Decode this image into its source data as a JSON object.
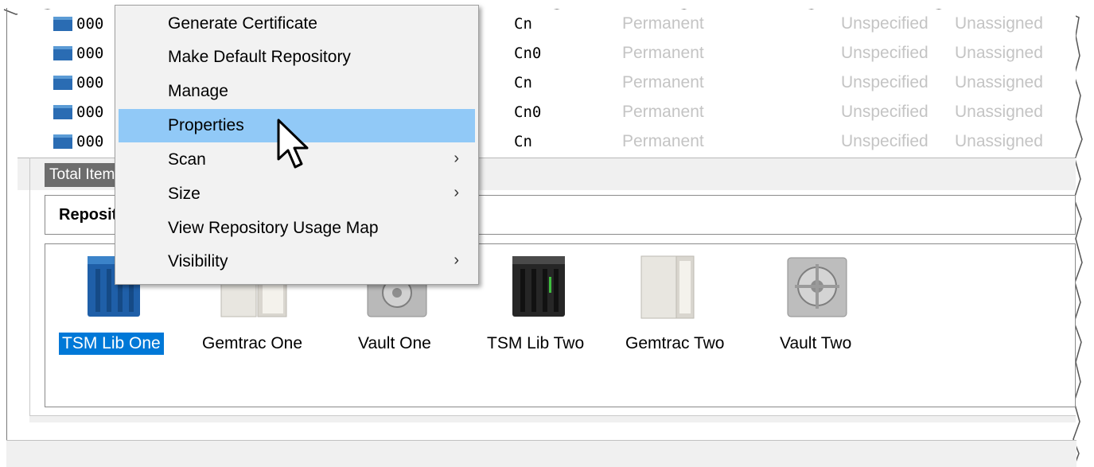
{
  "table": {
    "rows": [
      {
        "id": "000",
        "code": "Cn",
        "retention": "Permanent",
        "col_a": "Unspecified",
        "col_b": "Unassigned"
      },
      {
        "id": "000",
        "code": "Cn0",
        "retention": "Permanent",
        "col_a": "Unspecified",
        "col_b": "Unassigned"
      },
      {
        "id": "000",
        "code": "Cn",
        "retention": "Permanent",
        "col_a": "Unspecified",
        "col_b": "Unassigned"
      },
      {
        "id": "000",
        "code": "Cn0",
        "retention": "Permanent",
        "col_a": "Unspecified",
        "col_b": "Unassigned"
      },
      {
        "id": "000",
        "code": "Cn",
        "retention": "Permanent",
        "col_a": "Unspecified",
        "col_b": "Unassigned"
      }
    ],
    "total_label": "Total Items"
  },
  "repositories": {
    "header_label": "Repositories",
    "items": [
      {
        "label": "TSM Lib One",
        "icon": "tape-library-blue-icon",
        "selected": true
      },
      {
        "label": "Gemtrac One",
        "icon": "cabinet-icon",
        "selected": false
      },
      {
        "label": "Vault One",
        "icon": "vault-icon",
        "selected": false
      },
      {
        "label": "TSM Lib Two",
        "icon": "tape-library-black-icon",
        "selected": false
      },
      {
        "label": "Gemtrac Two",
        "icon": "cabinet-icon",
        "selected": false
      },
      {
        "label": "Vault Two",
        "icon": "vault-icon",
        "selected": false
      }
    ]
  },
  "context_menu": {
    "items": [
      {
        "label": "Generate Certificate",
        "submenu": false
      },
      {
        "label": "Make Default Repository",
        "submenu": false
      },
      {
        "label": "Manage",
        "submenu": false
      },
      {
        "label": "Properties",
        "submenu": false,
        "highlighted": true
      },
      {
        "label": "Scan",
        "submenu": true
      },
      {
        "label": "Size",
        "submenu": true
      },
      {
        "label": "View Repository Usage Map",
        "submenu": false
      },
      {
        "label": "Visibility",
        "submenu": true
      }
    ],
    "submenu_arrow": "›"
  },
  "colors": {
    "selection": "#0078d7",
    "menu_highlight": "#91c9f7",
    "muted_text": "#c4c4c4"
  }
}
